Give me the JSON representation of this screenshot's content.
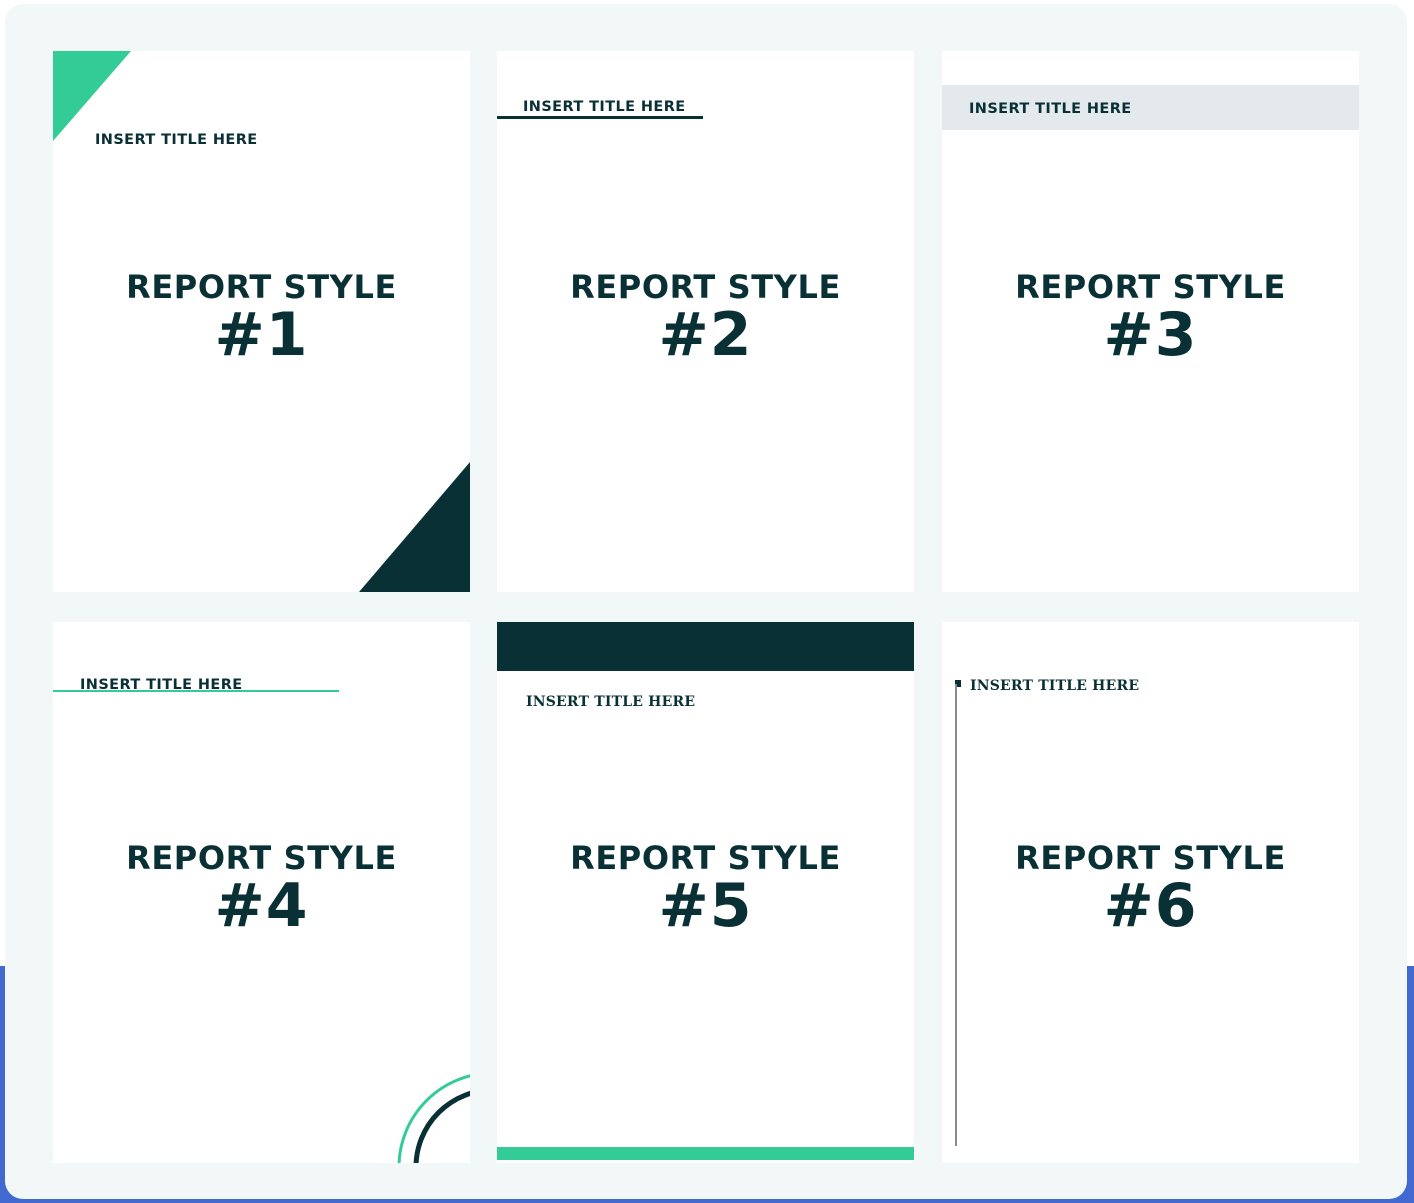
{
  "colors": {
    "dark_teal": "#093035",
    "green": "#33cc96",
    "light_gray": "#e4e9ed",
    "panel_bg": "#f2f8f8",
    "blue": "#4169cf"
  },
  "cards": [
    {
      "title": "INSERT TITLE HERE",
      "heading": "REPORT STYLE",
      "number": "#1"
    },
    {
      "title": "INSERT TITLE HERE",
      "heading": "REPORT STYLE",
      "number": "#2"
    },
    {
      "title": "INSERT TITLE HERE",
      "heading": "REPORT STYLE",
      "number": "#3"
    },
    {
      "title": "INSERT TITLE HERE",
      "heading": "REPORT STYLE",
      "number": "#4"
    },
    {
      "title": "INSERT TITLE HERE",
      "heading": "REPORT STYLE",
      "number": "#5"
    },
    {
      "title": "INSERT TITLE HERE",
      "heading": "REPORT STYLE",
      "number": "#6"
    }
  ]
}
